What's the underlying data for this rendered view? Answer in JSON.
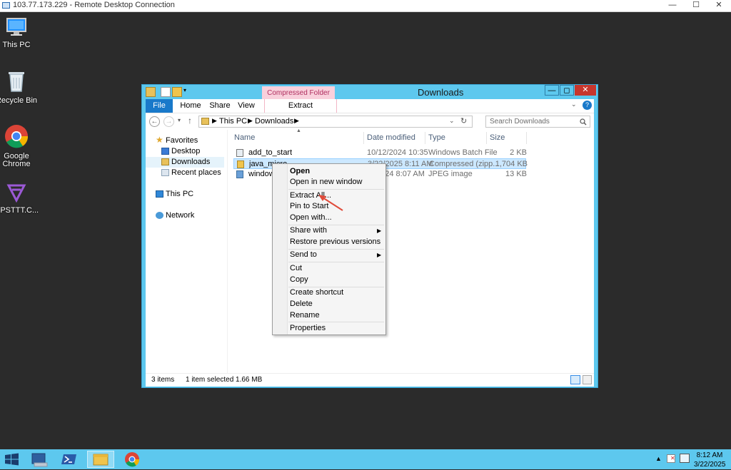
{
  "rdp": {
    "title": "103.77.173.229 - Remote Desktop Connection",
    "minimize": "—",
    "maximize": "☐",
    "close": "✕"
  },
  "desktop": {
    "icons": [
      {
        "label": "This PC",
        "icon": "computer-icon"
      },
      {
        "label": "Recycle Bin",
        "icon": "recycle-bin-icon"
      },
      {
        "label": "Google Chrome",
        "icon": "chrome-icon"
      },
      {
        "label": "VPSTTT.C...",
        "icon": "vpsttt-logo-icon"
      }
    ]
  },
  "explorer": {
    "title": "Downloads",
    "contextual_tab_group": "Compressed Folder Tools",
    "ribbon_tabs": [
      "File",
      "Home",
      "Share",
      "View",
      "Extract"
    ],
    "address": {
      "crumbs": [
        "This PC",
        "Downloads"
      ]
    },
    "search_placeholder": "Search Downloads",
    "nav": {
      "favorites": "Favorites",
      "desktop": "Desktop",
      "downloads": "Downloads",
      "recent": "Recent places",
      "this_pc": "This PC",
      "network": "Network"
    },
    "columns": [
      "Name",
      "Date modified",
      "Type",
      "Size"
    ],
    "files": [
      {
        "name": "add_to_start",
        "date": "10/12/2024 10:35 ...",
        "type": "Windows Batch File",
        "size": "2 KB"
      },
      {
        "name": "java_micro",
        "date": "3/22/2025 8:11 AM",
        "type": "Compressed (zipp...",
        "size": "1,704 KB"
      },
      {
        "name": "windows_",
        "date": "2024 8:07 AM",
        "type": "JPEG image",
        "size": "13 KB"
      }
    ],
    "status": {
      "count": "3 items",
      "selection": "1 item selected  1.66 MB"
    }
  },
  "context_menu": {
    "items": [
      "Open",
      "Open in new window",
      "Extract All...",
      "Pin to Start",
      "Open with...",
      "Share with",
      "Restore previous versions",
      "Send to",
      "Cut",
      "Copy",
      "Create shortcut",
      "Delete",
      "Rename",
      "Properties"
    ]
  },
  "taskbar": {
    "time": "8:12 AM",
    "date": "3/22/2025"
  },
  "colors": {
    "window_frame": "#5dc8ee",
    "file_tab": "#1979ca",
    "contextual_tab": "#f9d0dc",
    "selection": "#cce8ff",
    "annotation_arrow": "#e04b3a"
  }
}
